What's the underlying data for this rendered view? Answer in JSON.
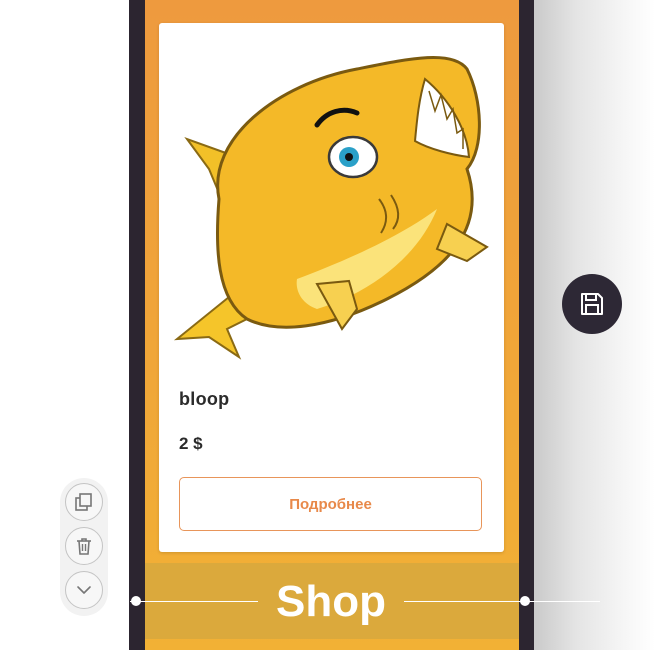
{
  "product": {
    "name": "bloop",
    "price": "2 $",
    "details_button_label": "Подробнее",
    "image_subject": "yellow-cartoon-fish"
  },
  "section": {
    "title": "Shop"
  },
  "floating_actions": {
    "save_icon": "floppy-disk-icon"
  },
  "toolbar": {
    "items": [
      {
        "icon": "duplicate-icon"
      },
      {
        "icon": "trash-icon"
      },
      {
        "icon": "chevron-down-icon"
      }
    ]
  },
  "colors": {
    "screen_top": "#ee9a3e",
    "screen_bottom": "#f2b135",
    "frame": "#2c2530",
    "accent": "#e8894a",
    "fab": "#2d2835"
  }
}
